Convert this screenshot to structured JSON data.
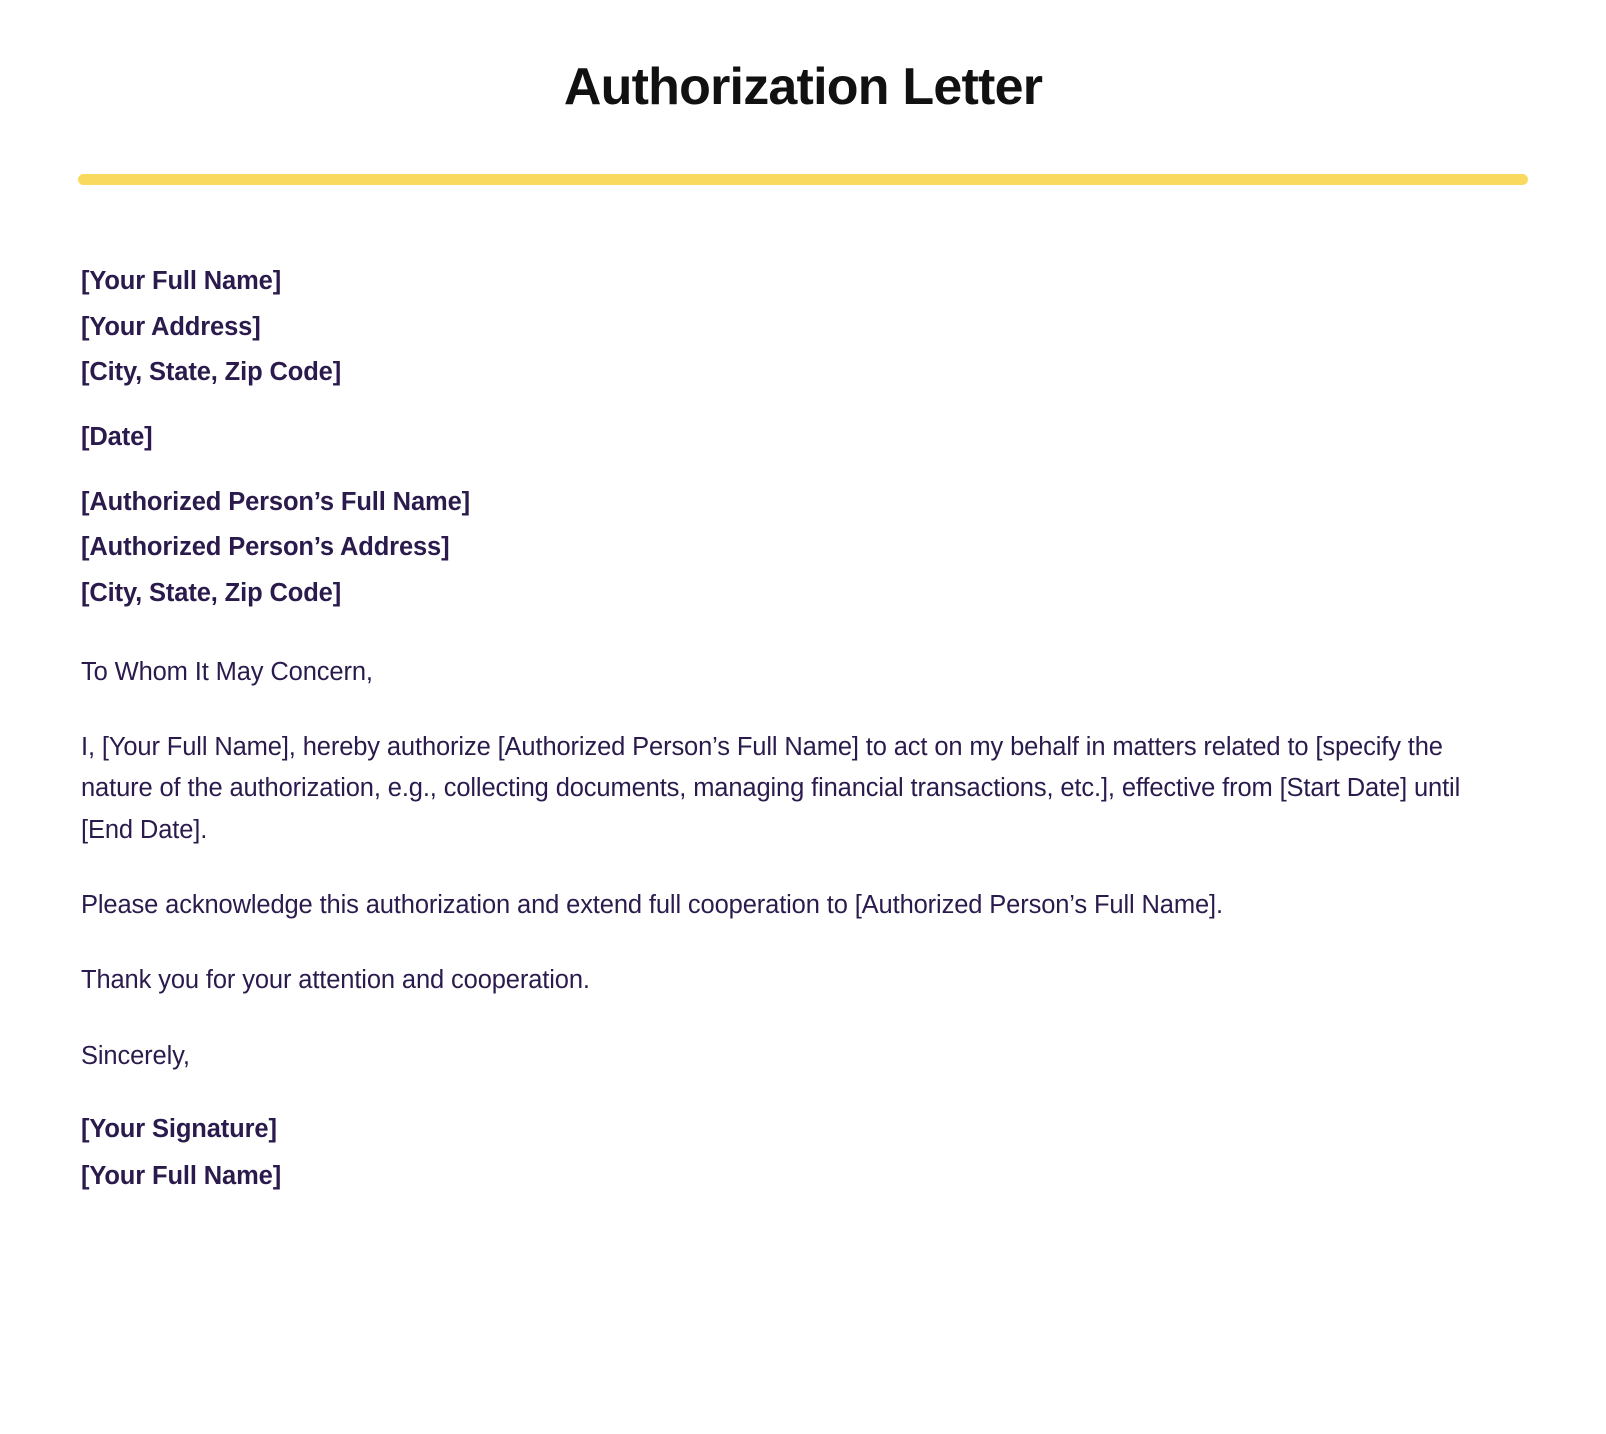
{
  "document": {
    "title": "Authorization Letter",
    "accent_color": "#F9DA5F",
    "title_color": "#111111",
    "text_color": "#2B1B4D",
    "background_color": "#FFFFFF"
  },
  "sender_block": {
    "name": "[Your Full Name]",
    "address": "[Your Address]",
    "city_state_zip": "[City, State, Zip Code]"
  },
  "date_block": {
    "date": "[Date]"
  },
  "recipient_block": {
    "name": "[Authorized Person’s Full Name]",
    "address": "[Authorized Person’s Address]",
    "city_state_zip": "[City, State, Zip Code]"
  },
  "body": {
    "salutation": "To Whom It May Concern,",
    "paragraph_1": "I, [Your Full Name], hereby authorize [Authorized Person’s Full Name] to act on my behalf in matters related to [specify the nature of the authorization, e.g., collecting documents, managing financial transactions, etc.], effective from [Start Date] until [End Date].",
    "paragraph_2": "Please acknowledge this authorization and extend full cooperation to [Authorized Person’s Full Name].",
    "paragraph_3": "Thank you for your attention and cooperation.",
    "closing": "Sincerely,"
  },
  "signature_block": {
    "signature": "[Your Signature]",
    "name": "[Your Full Name]"
  }
}
